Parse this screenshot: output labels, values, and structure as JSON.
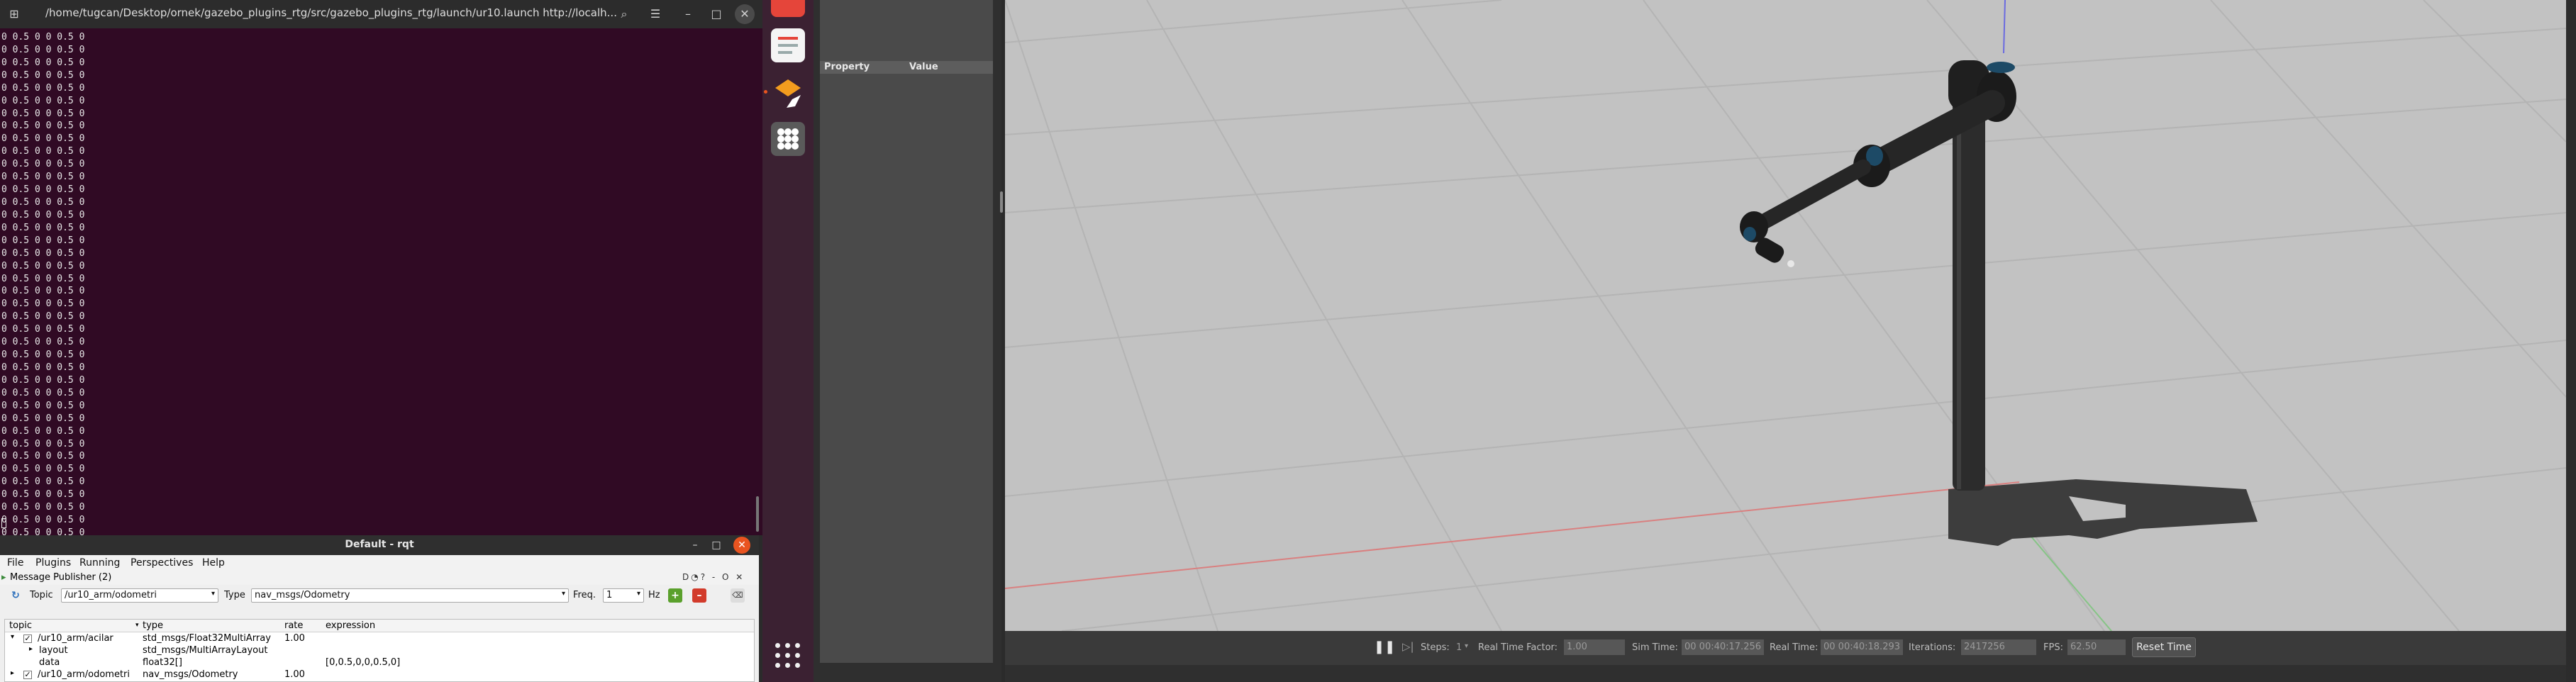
{
  "terminal": {
    "title": "/home/tugcan/Desktop/ornek/gazebo_plugins_rtg/src/gazebo_plugins_rtg/launch/ur10.launch http://localh...",
    "output_lines": [
      "0 0.5 0 0 0.5 0",
      "0 0.5 0 0 0.5 0",
      "0 0.5 0 0 0.5 0",
      "0 0.5 0 0 0.5 0",
      "0 0.5 0 0 0.5 0",
      "0 0.5 0 0 0.5 0",
      "0 0.5 0 0 0.5 0",
      "0 0.5 0 0 0.5 0",
      "0 0.5 0 0 0.5 0",
      "0 0.5 0 0 0.5 0",
      "0 0.5 0 0 0.5 0",
      "0 0.5 0 0 0.5 0",
      "0 0.5 0 0 0.5 0",
      "0 0.5 0 0 0.5 0",
      "0 0.5 0 0 0.5 0",
      "0 0.5 0 0 0.5 0",
      "0 0.5 0 0 0.5 0",
      "0 0.5 0 0 0.5 0",
      "0 0.5 0 0 0.5 0",
      "0 0.5 0 0 0.5 0",
      "0 0.5 0 0 0.5 0",
      "0 0.5 0 0 0.5 0",
      "0 0.5 0 0 0.5 0",
      "0 0.5 0 0 0.5 0",
      "0 0.5 0 0 0.5 0",
      "0 0.5 0 0 0.5 0",
      "0 0.5 0 0 0.5 0",
      "0 0.5 0 0 0.5 0",
      "0 0.5 0 0 0.5 0",
      "0 0.5 0 0 0.5 0",
      "0 0.5 0 0 0.5 0",
      "0 0.5 0 0 0.5 0",
      "0 0.5 0 0 0.5 0",
      "0 0.5 0 0 0.5 0",
      "0 0.5 0 0 0.5 0",
      "0 0.5 0 0 0.5 0",
      "0 0.5 0 0 0.5 0",
      "0 0.5 0 0 0.5 0",
      "0 0.5 0 0 0.5 0",
      "0 0.5 0 0 0.5 0"
    ]
  },
  "rqt": {
    "title": "Default - rqt",
    "menu": [
      "File",
      "Plugins",
      "Running",
      "Perspectives",
      "Help"
    ],
    "plugin_title": "Message Publisher (2)",
    "plugin_icons": "D◔? - O ✕",
    "topic_label": "Topic",
    "topic_value": "/ur10_arm/odometri",
    "type_label": "Type",
    "type_value": "nav_msgs/Odometry",
    "freq_label": "Freq.",
    "freq_value": "1",
    "hz_label": "Hz",
    "columns": [
      "topic",
      "type",
      "rate",
      "expression"
    ],
    "rows": [
      {
        "topic": "/ur10_arm/acilar",
        "type": "std_msgs/Float32MultiArray",
        "rate": "1.00",
        "expression": ""
      },
      {
        "topic": "layout",
        "type": "std_msgs/MultiArrayLayout",
        "rate": "",
        "expression": ""
      },
      {
        "topic": "data",
        "type": "float32[]",
        "rate": "",
        "expression": "[0,0.5,0,0,0.5,0]"
      },
      {
        "topic": "/ur10_arm/odometri",
        "type": "nav_msgs/Odometry",
        "rate": "1.00",
        "expression": ""
      }
    ]
  },
  "property_panel": {
    "col_property": "Property",
    "col_value": "Value"
  },
  "gazebo_bar": {
    "steps_label": "Steps:",
    "steps_value": "1",
    "rtf_label": "Real Time Factor:",
    "rtf_value": "1.00",
    "sim_time_label": "Sim Time:",
    "sim_time_value": "00 00:40:17.256",
    "real_time_label": "Real Time:",
    "real_time_value": "00 00:40:18.293",
    "iterations_label": "Iterations:",
    "iterations_value": "2417256",
    "fps_label": "FPS:",
    "fps_value": "62.50",
    "reset_label": "Reset Time"
  },
  "colors": {
    "terminal_bg": "#300a24",
    "accent": "#e95420",
    "viewport_bg": "#c2c2c2"
  }
}
